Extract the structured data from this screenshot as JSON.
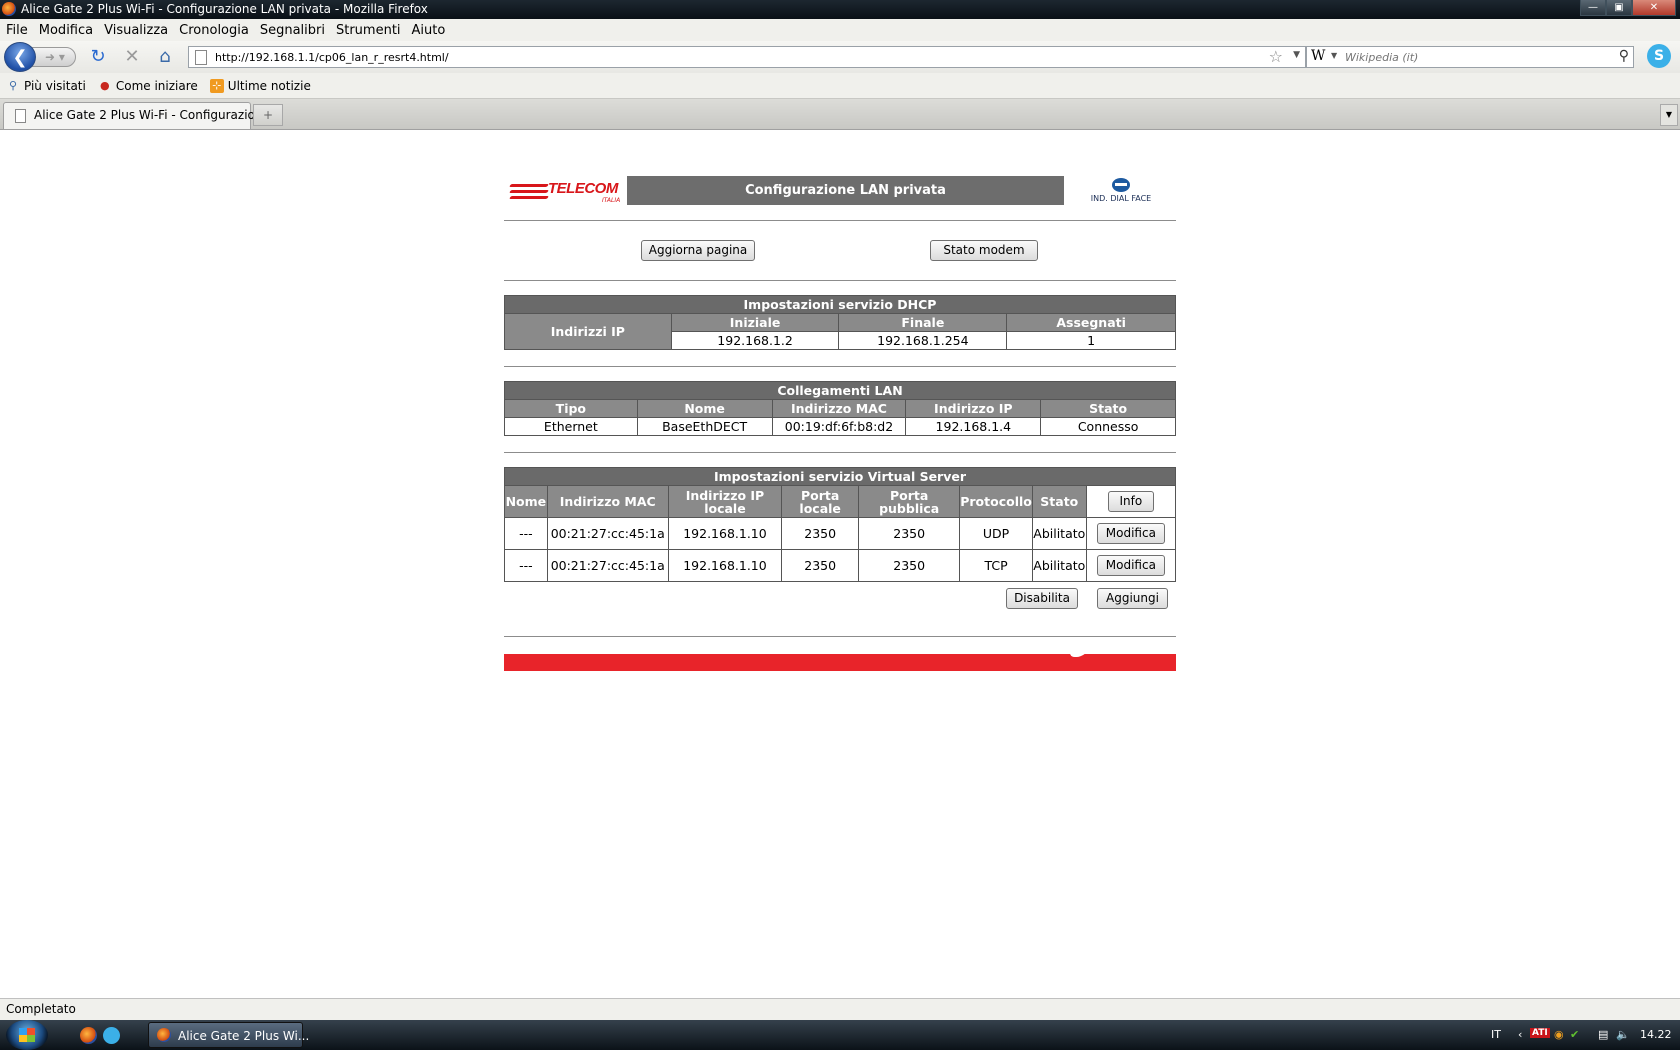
{
  "window": {
    "title": "Alice Gate 2 Plus Wi-Fi - Configurazione LAN privata - Mozilla Firefox"
  },
  "menu": [
    "File",
    "Modifica",
    "Visualizza",
    "Cronologia",
    "Segnalibri",
    "Strumenti",
    "Aiuto"
  ],
  "nav": {
    "url": "http://192.168.1.1/cp06_lan_r_resrt4.html/",
    "search_engine": "W",
    "search_placeholder": "Wikipedia (it)"
  },
  "bookmarks": [
    "Più visitati",
    "Come iniziare",
    "Ultime notizie"
  ],
  "tab": {
    "label": "Alice Gate 2 Plus Wi-Fi - Configurazio...",
    "new_tab": "+"
  },
  "router": {
    "logo_text": "TELECOM",
    "logo_sub": "ITALIA",
    "header_title": "Configurazione LAN privata",
    "dial_face": "IND. DIAL FACE",
    "buttons": {
      "refresh": "Aggiorna pagina",
      "modem_status": "Stato modem"
    },
    "dhcp": {
      "title": "Impostazioni servizio DHCP",
      "row_label": "Indirizzi IP",
      "headers": [
        "Iniziale",
        "Finale",
        "Assegnati"
      ],
      "values": [
        "192.168.1.2",
        "192.168.1.254",
        "1"
      ]
    },
    "lan": {
      "title": "Collegamenti LAN",
      "headers": [
        "Tipo",
        "Nome",
        "Indirizzo MAC",
        "Indirizzo IP",
        "Stato"
      ],
      "rows": [
        [
          "Ethernet",
          "BaseEthDECT",
          "00:19:df:6f:b8:d2",
          "192.168.1.4",
          "Connesso"
        ]
      ]
    },
    "vs": {
      "title": "Impostazioni servizio Virtual Server",
      "headers": [
        "Nome",
        "Indirizzo MAC",
        "Indirizzo IP locale",
        "Porta locale",
        "Porta pubblica",
        "Protocollo",
        "Stato"
      ],
      "info_button": "Info",
      "rows": [
        [
          "---",
          "00:21:27:cc:45:1a",
          "192.168.1.10",
          "2350",
          "2350",
          "UDP",
          "Abilitato"
        ],
        [
          "---",
          "00:21:27:cc:45:1a",
          "192.168.1.10",
          "2350",
          "2350",
          "TCP",
          "Abilitato"
        ]
      ],
      "edit_button": "Modifica",
      "disable_button": "Disabilita",
      "add_button": "Aggiungi"
    }
  },
  "status": "Completato",
  "taskbar": {
    "task_label": "Alice Gate 2 Plus Wi...",
    "lang": "IT",
    "clock": "14.22"
  }
}
